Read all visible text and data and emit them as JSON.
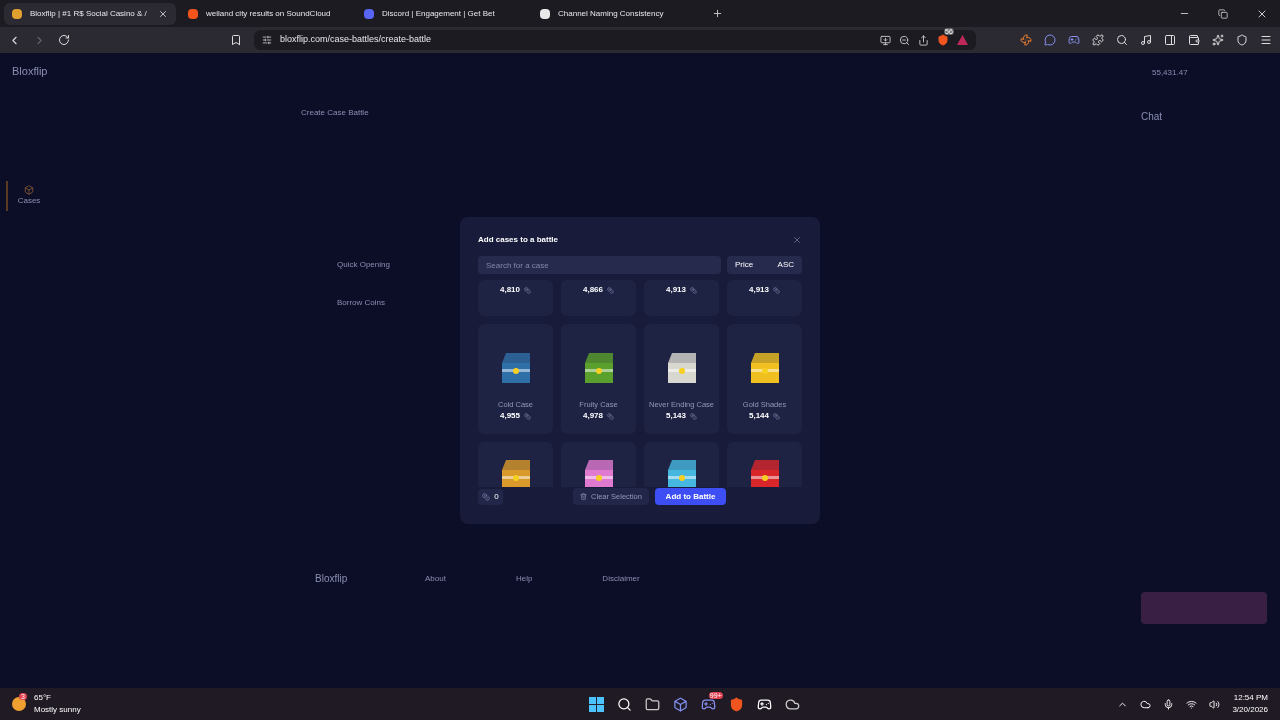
{
  "browser": {
    "tabs": [
      {
        "title": "Bloxflip | #1 R$ Social Casino & /",
        "selected": true,
        "color": "#e0a030"
      },
      {
        "title": "weiland city results on SoundCloud",
        "selected": false,
        "color": "#f2541b"
      },
      {
        "title": "Discord | Engagement | Get Bet",
        "selected": false,
        "color": "#5865f2"
      },
      {
        "title": "Channel Naming Consistency",
        "selected": false,
        "color": "#e8e8e8"
      }
    ],
    "url": "bloxflip.com/case-battles/create-battle",
    "shield_count": "56"
  },
  "site": {
    "logo": "Bloxflip",
    "sidebar": [
      {
        "label": "Cases",
        "selected": true
      }
    ],
    "page_title": "Create Case Battle",
    "options": [
      "Quick Opening",
      "Borrow Coins"
    ],
    "balance": "55,431.47",
    "chat_title": "Chat",
    "footer": {
      "logo": "Bloxflip",
      "columns": [
        "About",
        "Help",
        "Disclaimer"
      ]
    }
  },
  "modal": {
    "title": "Add cases to a battle",
    "search_placeholder": "Search for a case",
    "sort_label": "Price",
    "sort_order": "ASC",
    "cases": [
      {
        "price": "4,810"
      },
      {
        "price": "4,866"
      },
      {
        "price": "4,913"
      },
      {
        "price": "4,913"
      },
      {
        "name": "Cold Case",
        "price": "4,955",
        "color": "#2f6fa8"
      },
      {
        "name": "Fruity Case",
        "price": "4,978",
        "color": "#5aa02c"
      },
      {
        "name": "Never Ending Case",
        "price": "5,143",
        "color": "#d8d8d0"
      },
      {
        "name": "Gold Shades",
        "price": "5,144",
        "color": "#f0c020"
      },
      {
        "color": "#d99a2b"
      },
      {
        "color": "#e07ad0"
      },
      {
        "color": "#46b8e0"
      },
      {
        "color": "#d8262a"
      }
    ],
    "selected_count": "0",
    "clear_label": "Clear Selection",
    "add_label": "Add to Battle"
  },
  "taskbar": {
    "temperature": "65°F",
    "weather": "Mostly sunny",
    "weather_badge": "3",
    "discord_badge": "99+",
    "time": "12:54 PM",
    "date": "3/20/2026"
  }
}
